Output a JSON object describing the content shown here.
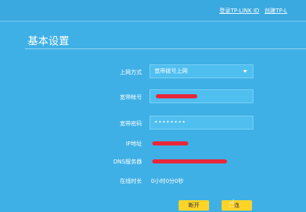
{
  "header": {
    "login_link": "登录TP-LINK ID",
    "create_link": "创建TP-L"
  },
  "page": {
    "title": "基本设置"
  },
  "form": {
    "connection_type_label": "上网方式",
    "connection_type_value": "宽带拨号上网",
    "account_label": "宽带帐号",
    "password_label": "宽带密码",
    "password_value": "••••••••",
    "ip_label": "IP地址",
    "dns_label": "DNS服务器",
    "online_time_label": "在线时长",
    "online_time_value": "0小时0分0秒"
  },
  "buttons": {
    "disconnect": "断开",
    "connect": "连"
  },
  "colors": {
    "background": "#3fb0e6",
    "field": "#4fbff0",
    "redaction": "#e8283a",
    "button": "#ffd429"
  }
}
